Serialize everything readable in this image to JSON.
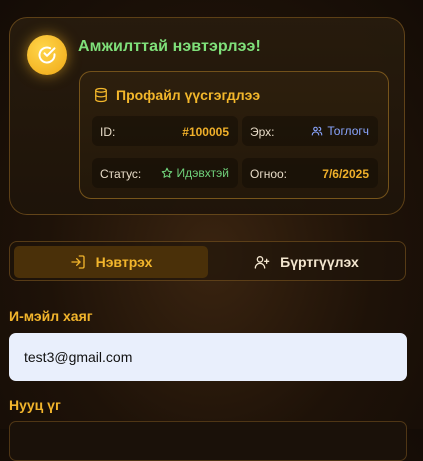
{
  "success": {
    "title": "Амжилттай нэвтэрлээ!",
    "icon": "check-circle-icon"
  },
  "profile": {
    "title": "Профайл үүсгэгдлээ",
    "icon": "database-icon",
    "fields": {
      "id": {
        "label": "ID:",
        "value": "#100005"
      },
      "role": {
        "label": "Эрх:",
        "value": "Тоглогч",
        "icon": "users-icon"
      },
      "status": {
        "label": "Статус:",
        "value": "Идэвхтэй",
        "icon": "star-icon"
      },
      "date": {
        "label": "Огноо:",
        "value": "7/6/2025"
      }
    }
  },
  "tabs": {
    "login": {
      "label": "Нэвтрэх",
      "icon": "login-icon",
      "active": true
    },
    "register": {
      "label": "Бүртгүүлэх",
      "icon": "user-plus-icon",
      "active": false
    }
  },
  "form": {
    "email_label": "И-мэйл хаяг",
    "email_value": "test3@gmail.com",
    "password_label": "Нууц үг",
    "password_value": ""
  },
  "colors": {
    "accent": "#f2b52c",
    "success": "#7fe07a",
    "role": "#8aa6ff",
    "status": "#6fd07a"
  }
}
